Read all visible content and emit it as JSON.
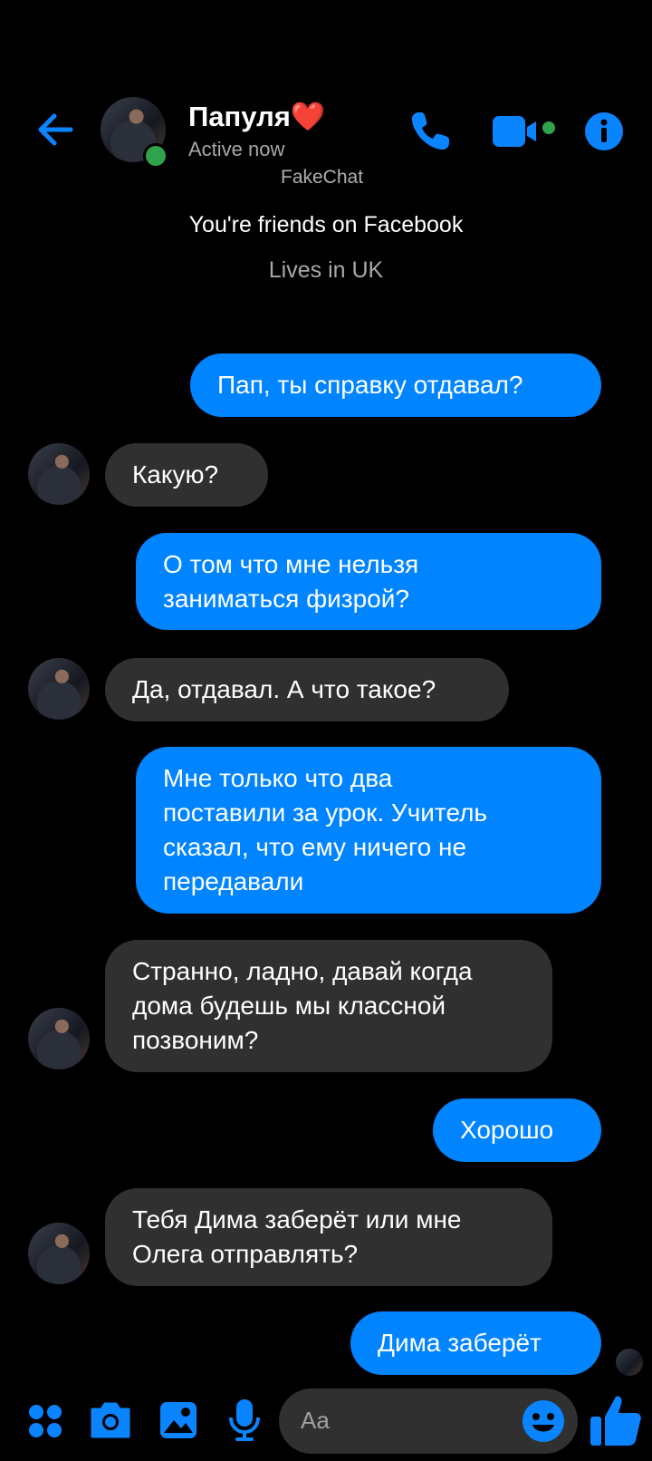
{
  "header": {
    "contact_name": "Папуля❤️",
    "status": "Active now",
    "icons": [
      "back-arrow-icon",
      "phone-icon",
      "video-camera-icon",
      "info-icon"
    ]
  },
  "watermark": "FakeChat",
  "profile_info": {
    "friends_text": "You're friends on Facebook",
    "location_text": "Lives in UK"
  },
  "messages": [
    {
      "direction": "out",
      "text": "Пап, ты справку отдавал?"
    },
    {
      "direction": "in",
      "text": "Какую?"
    },
    {
      "direction": "out",
      "text": "О том что мне нельзя\nзаниматься физрой?"
    },
    {
      "direction": "in",
      "text": "Да, отдавал. А что такое?"
    },
    {
      "direction": "out",
      "text": "Мне только что два\nпоставили за урок. Учитель\nсказал, что ему ничего не\nпередавали"
    },
    {
      "direction": "in",
      "text": "Странно, ладно, давай когда\nдома будешь мы классной\nпозвоним?"
    },
    {
      "direction": "out",
      "text": "Хорошо"
    },
    {
      "direction": "in",
      "text": "Тебя Дима заберёт или мне\nОлега отправлять?"
    },
    {
      "direction": "out",
      "text": "Дима заберёт"
    }
  ],
  "composer": {
    "placeholder": "Aa",
    "icons": [
      "menu-dots-icon",
      "camera-icon",
      "gallery-icon",
      "microphone-icon",
      "emoji-icon",
      "thumbs-up-icon"
    ]
  },
  "colors": {
    "accent": "#0084ff",
    "incoming_bubble": "#303030",
    "online": "#31a24c",
    "background": "#000000"
  }
}
